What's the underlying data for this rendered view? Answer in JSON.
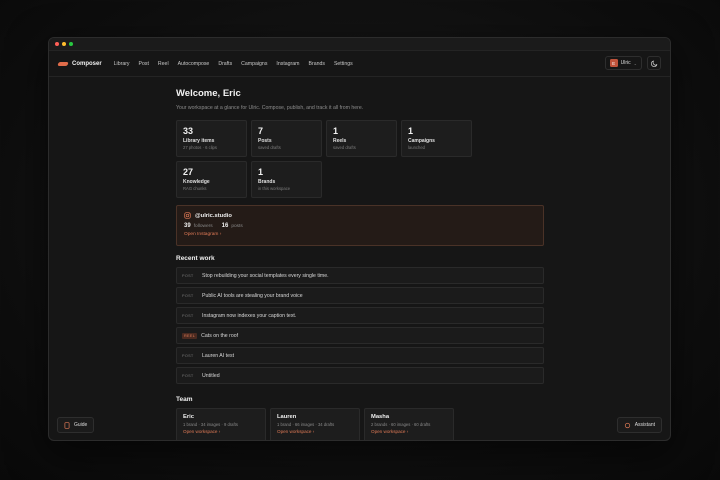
{
  "nav": {
    "brand": "Composer",
    "items": [
      "Library",
      "Post",
      "Reel",
      "Autocompose",
      "Drafts",
      "Campaigns",
      "Instagram",
      "Brands",
      "Settings"
    ],
    "user": {
      "initial": "E",
      "name": "Ulric"
    }
  },
  "header": {
    "title": "Welcome, Eric",
    "subtitle": "Your workspace at a glance for Ulric. Compose, publish, and track it all from here."
  },
  "stats": [
    {
      "value": "33",
      "label": "Library items",
      "sub": "27 photos · 6 clips"
    },
    {
      "value": "7",
      "label": "Posts",
      "sub": "saved drafts"
    },
    {
      "value": "1",
      "label": "Reels",
      "sub": "saved drafts"
    },
    {
      "value": "1",
      "label": "Campaigns",
      "sub": "launched"
    },
    {
      "value": "27",
      "label": "Knowledge",
      "sub": "RAG chunks"
    },
    {
      "value": "1",
      "label": "Brands",
      "sub": "in this workspace"
    }
  ],
  "instagram": {
    "handle": "@ulric.studio",
    "followers": "39",
    "followers_label": "followers",
    "posts": "16",
    "posts_label": "posts",
    "link": "Open Instagram ›"
  },
  "recent": {
    "title": "Recent work",
    "items": [
      {
        "tag": "POST",
        "title": "Stop rebuilding your social templates every single time."
      },
      {
        "tag": "POST",
        "title": "Public AI tools are stealing your brand voice"
      },
      {
        "tag": "POST",
        "title": "Instagram now indexes your caption text."
      },
      {
        "tag": "REEL",
        "title": "Cats on the roof"
      },
      {
        "tag": "POST",
        "title": "Lauren AI test"
      },
      {
        "tag": "POST",
        "title": "Untitled"
      }
    ]
  },
  "team": {
    "title": "Team",
    "members": [
      {
        "name": "Eric",
        "meta": "1 brand · 34 images · 9 drafts",
        "link": "Open workspace ›"
      },
      {
        "name": "Lauren",
        "meta": "1 brand · 66 images · 34 drafts",
        "link": "Open workspace ›"
      },
      {
        "name": "Masha",
        "meta": "2 brands · 60 images · 60 drafts",
        "link": "Open workspace ›"
      }
    ]
  },
  "buttons": {
    "guide": "Guide",
    "assistant": "Assistant"
  },
  "colors": {
    "accent": "#e07a56",
    "background": "#161616"
  }
}
